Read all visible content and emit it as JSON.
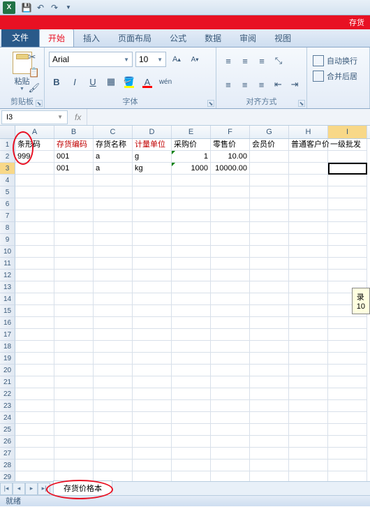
{
  "title_suffix": "存货",
  "qat": {
    "app_initial": "X"
  },
  "tabs": {
    "file": "文件",
    "home": "开始",
    "insert": "插入",
    "layout": "页面布局",
    "formula": "公式",
    "data": "数据",
    "review": "审阅",
    "view": "视图"
  },
  "ribbon": {
    "clipboard": {
      "paste": "粘贴",
      "label": "剪贴板"
    },
    "font": {
      "name": "Arial",
      "size": "10",
      "label": "字体",
      "bold": "B",
      "italic": "I",
      "underline": "U"
    },
    "align": {
      "label": "对齐方式"
    },
    "wrap": {
      "wrap": "自动换行",
      "merge": "合并后居"
    }
  },
  "namebox": {
    "ref": "I3",
    "fx": "fx"
  },
  "columns": [
    "A",
    "B",
    "C",
    "D",
    "E",
    "F",
    "G",
    "H",
    "I"
  ],
  "headers": {
    "A": "条形码",
    "B": "存货编码",
    "C": "存货名称",
    "D": "计量单位",
    "E": "采购价",
    "F": "零售价",
    "G": "会员价",
    "H": "普通客户价",
    "I": "一级批发"
  },
  "header_red": [
    "B",
    "D"
  ],
  "data_rows": [
    {
      "A": "999",
      "B": "001",
      "C": "a",
      "D": "g",
      "E": "1",
      "F": "10.00",
      "G": "",
      "H": "",
      "I": ""
    },
    {
      "A": "",
      "B": "001",
      "C": "a",
      "D": "kg",
      "E": "1000",
      "F": "10000.00",
      "G": "",
      "H": "",
      "I": ""
    }
  ],
  "green_tri": [
    [
      "2",
      "E"
    ],
    [
      "3",
      "E"
    ]
  ],
  "active_cell": {
    "row": 3,
    "col": "I"
  },
  "tooltip": {
    "line1": "录",
    "line2": "10"
  },
  "sheet_tab": "存货价格本",
  "status": "就绪",
  "row_count": 29
}
